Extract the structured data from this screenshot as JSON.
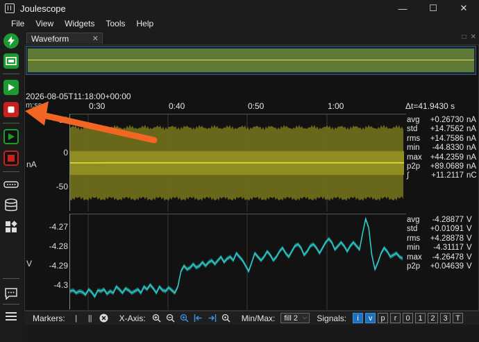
{
  "app": {
    "title": "Joulescope"
  },
  "window_controls": {
    "minimize": "—",
    "maximize": "☐",
    "close": "✕"
  },
  "menu": [
    "File",
    "View",
    "Widgets",
    "Tools",
    "Help"
  ],
  "toolbar": {
    "items": [
      "lightning-icon",
      "chip-icon",
      "play-icon",
      "stop-icon",
      "record-play-icon",
      "record-stop-icon",
      "device-icon",
      "database-icon",
      "widgets-icon",
      "chat-icon",
      "menu-icon"
    ]
  },
  "tab": {
    "label": "Waveform",
    "close": "✕",
    "dock_icons": [
      "□",
      "✕"
    ]
  },
  "waveform": {
    "timestamp": "2026-08-05T11:18:00+00:00",
    "x_unit": "m:ss",
    "delta_t": "Δt=41.9430 s",
    "colors": {
      "current": "#e7e23b",
      "voltage": "#2ec8c8",
      "band_current": "#6f6d1a",
      "band_voltage": "#1f6b6b"
    }
  },
  "chart_data": [
    {
      "type": "line",
      "title": "",
      "x_ticks": [
        "0:30",
        "0:40",
        "0:50",
        "1:00"
      ],
      "xlabel": "m:ss",
      "ylabel": "nA",
      "y_ticks": [
        "50",
        "0",
        "-50"
      ],
      "ylim": [
        -60,
        60
      ],
      "series": [
        {
          "values": [
            0.2,
            0.3,
            0.25,
            0.3,
            0.28,
            0.26,
            0.3,
            0.27,
            0.26,
            0.29
          ]
        }
      ],
      "stats": [
        {
          "name": "avg",
          "value": "+0.26730",
          "unit": "nA"
        },
        {
          "name": "std",
          "value": "+14.7562",
          "unit": "nA"
        },
        {
          "name": "rms",
          "value": "+14.7586",
          "unit": "nA"
        },
        {
          "name": "min",
          "value": "-44.8330",
          "unit": "nA"
        },
        {
          "name": "max",
          "value": "+44.2359",
          "unit": "nA"
        },
        {
          "name": "p2p",
          "value": "+89.0689",
          "unit": "nA"
        },
        {
          "name": "∫",
          "value": "+11.2117",
          "unit": "nC"
        }
      ]
    },
    {
      "type": "line",
      "title": "",
      "x_ticks": [
        "0:30",
        "0:40",
        "0:50",
        "1:00"
      ],
      "xlabel": "m:ss",
      "ylabel": "V",
      "y_ticks": [
        "-4.27",
        "-4.28",
        "-4.29",
        "-4.3"
      ],
      "ylim": [
        -4.315,
        -4.262
      ],
      "series": [
        {
          "values": [
            -4.3045,
            -4.304,
            -4.3055,
            -4.3045,
            -4.305,
            -4.3065,
            -4.3035,
            -4.305,
            -4.3075,
            -4.304,
            -4.3045,
            -4.3035,
            -4.306,
            -4.3045,
            -4.3055,
            -4.302,
            -4.3035,
            -4.3055,
            -4.303,
            -4.304,
            -4.3055,
            -4.3045,
            -4.3035,
            -4.3055,
            -4.302,
            -4.3035,
            -4.301,
            -4.303,
            -4.3055,
            -4.302,
            -4.304,
            -4.3045,
            -4.3025,
            -4.304,
            -4.3055,
            -4.302,
            -4.2935,
            -4.2905,
            -4.2925,
            -4.2915,
            -4.2895,
            -4.2915,
            -4.2905,
            -4.2885,
            -4.2905,
            -4.2885,
            -4.2875,
            -4.2895,
            -4.2875,
            -4.2855,
            -4.2885,
            -4.2865,
            -4.2855,
            -4.2875,
            -4.2835,
            -4.2855,
            -4.2875,
            -4.2905,
            -4.2935,
            -4.2885,
            -4.2835,
            -4.2855,
            -4.2875,
            -4.2855,
            -4.2825,
            -4.2845,
            -4.2875,
            -4.2855,
            -4.2825,
            -4.2805,
            -4.2835,
            -4.2855,
            -4.2825,
            -4.2795,
            -4.2785,
            -4.2805,
            -4.2845,
            -4.2825,
            -4.2795,
            -4.2785,
            -4.2805,
            -4.2835,
            -4.2805,
            -4.2775,
            -4.2755,
            -4.2775,
            -4.2815,
            -4.2795,
            -4.2775,
            -4.2795,
            -4.2825,
            -4.2795,
            -4.2775,
            -4.2795,
            -4.2815,
            -4.2725,
            -4.2645,
            -4.2695,
            -4.2845,
            -4.2925,
            -4.2885,
            -4.2835,
            -4.2805,
            -4.2825,
            -4.2855,
            -4.2845,
            -4.2835,
            -4.2855,
            -4.2865
          ]
        }
      ],
      "stats": [
        {
          "name": "avg",
          "value": "-4.28877",
          "unit": "V"
        },
        {
          "name": "std",
          "value": "+0.01091",
          "unit": "V"
        },
        {
          "name": "rms",
          "value": "+4.28878",
          "unit": "V"
        },
        {
          "name": "min",
          "value": "-4.31117",
          "unit": "V"
        },
        {
          "name": "max",
          "value": "-4.26478",
          "unit": "V"
        },
        {
          "name": "p2p",
          "value": "+0.04639",
          "unit": "V"
        }
      ]
    }
  ],
  "bottom": {
    "markers_label": "Markers:",
    "marker_single": "|",
    "marker_dual": "||",
    "xaxis_label": "X-Axis:",
    "minmax_label": "Min/Max:",
    "minmax_value": "fill 2",
    "signals_label": "Signals:",
    "signals": [
      {
        "label": "i",
        "active": true
      },
      {
        "label": "v",
        "active": true
      },
      {
        "label": "p",
        "active": false
      },
      {
        "label": "r",
        "active": false
      },
      {
        "label": "0",
        "active": false
      },
      {
        "label": "1",
        "active": false
      },
      {
        "label": "2",
        "active": false
      },
      {
        "label": "3",
        "active": false
      },
      {
        "label": "T",
        "active": false
      }
    ]
  }
}
